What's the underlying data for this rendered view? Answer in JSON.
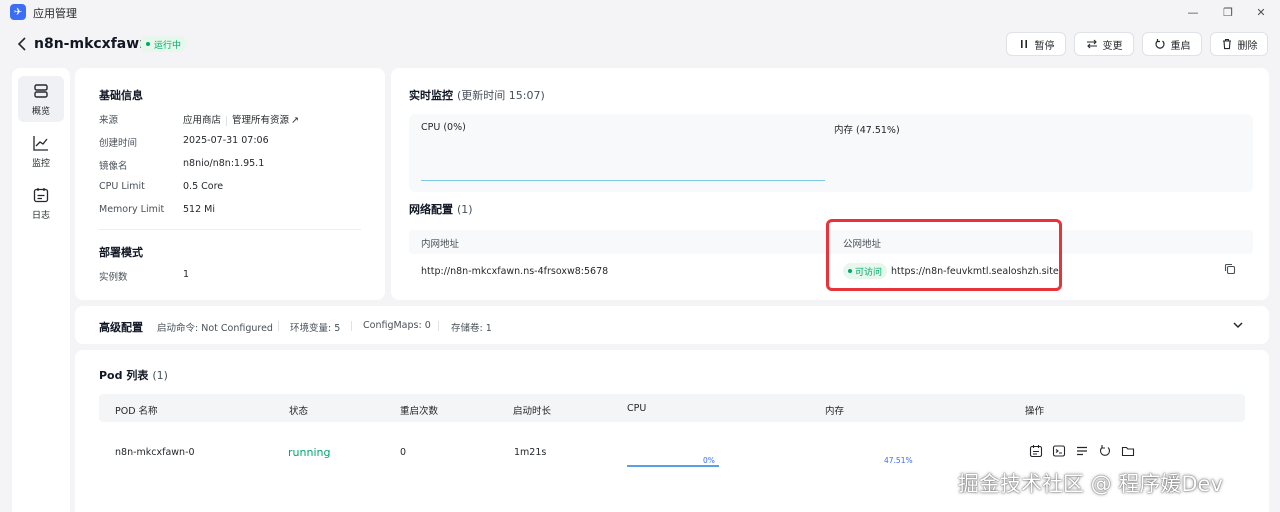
{
  "window": {
    "title": "应用管理"
  },
  "header": {
    "app_name": "n8n-mkcxfawn",
    "status": "运行中",
    "buttons": {
      "pause": "暂停",
      "change": "变更",
      "restart": "重启",
      "delete": "删除"
    }
  },
  "sidenav": {
    "items": [
      {
        "label": "概览",
        "icon": "overview-icon"
      },
      {
        "label": "监控",
        "icon": "chart-icon"
      },
      {
        "label": "日志",
        "icon": "calendar-icon"
      }
    ]
  },
  "basic_info": {
    "title": "基础信息",
    "rows": [
      {
        "key": "来源",
        "value": "应用商店",
        "extra": "管理所有资源"
      },
      {
        "key": "创建时间",
        "value": "2025-07-31 07:06"
      },
      {
        "key": "镜像名",
        "value": "n8nio/n8n:1.95.1"
      },
      {
        "key": "CPU Limit",
        "value": "0.5 Core"
      },
      {
        "key": "Memory Limit",
        "value": "512 Mi"
      }
    ]
  },
  "deploy": {
    "title": "部署模式",
    "rows": [
      {
        "key": "实例数",
        "value": "1"
      }
    ]
  },
  "monitor": {
    "title": "实时监控",
    "updated": "(更新时间  15:07)",
    "cpu_label": "CPU  (0%)",
    "mem_label": "内存  (47.51%)"
  },
  "network": {
    "title": "网络配置",
    "count": "(1)",
    "col_internal": "内网地址",
    "col_public": "公网地址",
    "internal_url": "http://n8n-mkcxfawn.ns-4frsoxw8:5678",
    "access_status": "可访问",
    "public_url": "https://n8n-feuvkmtl.sealoshzh.site"
  },
  "advanced": {
    "title": "高级配置",
    "items": [
      "启动命令: Not Configured",
      "环境变量: 5",
      "ConfigMaps: 0",
      "存储卷: 1"
    ]
  },
  "pods": {
    "title": "Pod 列表",
    "count": "(1)",
    "columns": [
      "POD 名称",
      "状态",
      "重启次数",
      "启动时长",
      "CPU",
      "内存",
      "操作"
    ],
    "rows": [
      {
        "name": "n8n-mkcxfawn-0",
        "status": "running",
        "restarts": "0",
        "uptime": "1m21s",
        "cpu": "0%",
        "cpu_fraction": 0,
        "mem": "47.51%",
        "mem_fraction": 0.4751
      }
    ]
  },
  "watermark": "掘金技术社区 @ 程序媛Dev",
  "colors": {
    "accent": "#00a86b",
    "highlight": "#e8333a",
    "bar": "#5aa0e8"
  }
}
